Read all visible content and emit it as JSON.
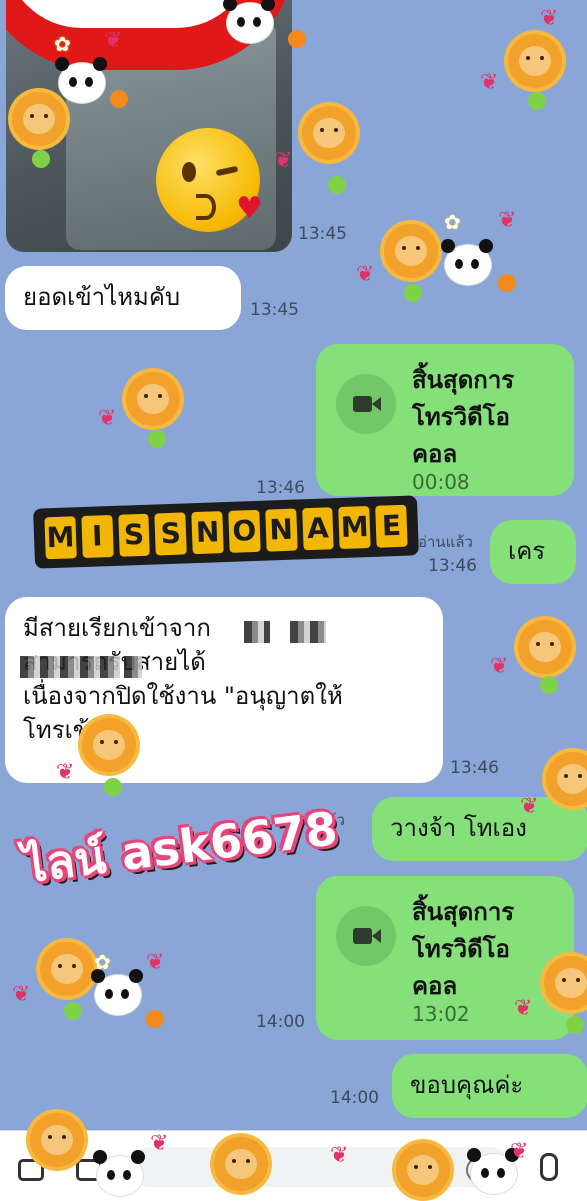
{
  "messages": {
    "image": {
      "time": "13:45"
    },
    "in1": {
      "text": "ยอดเข้าไหมคับ",
      "time": "13:45"
    },
    "call1": {
      "title": "สิ้นสุดการ\nโทรวิดีโอ\nคอล",
      "duration": "00:08",
      "time": "13:46"
    },
    "out1": {
      "text": "เคร",
      "read": "อ่านแล้ว",
      "time": "13:46"
    },
    "in2": {
      "text": "มีสายเรียกเข้าจาก\nสามารถรับสายได้\nเนื่องจากปิดใช้งาน \"อนุญาตให้\nโทรเข้",
      "time": "13:46"
    },
    "out2": {
      "text": "วางจ้า โทเอง",
      "read": "อ่านแล้ว"
    },
    "call2": {
      "title": "สิ้นสุดการ\nโทรวิดีโอ\nคอล",
      "duration": "13:02",
      "time": "14:00"
    },
    "out3": {
      "text": "ขอบคุณค่ะ",
      "time": "14:00"
    }
  },
  "watermark": {
    "letters": [
      "M",
      "I",
      "S",
      "S",
      "N",
      "O",
      "N",
      "A",
      "M",
      "E"
    ]
  },
  "overlay": {
    "line_id": "ไลน์ ask6678"
  },
  "colors": {
    "chat_bg": "#8aa6d6",
    "outgoing": "#85e07a",
    "incoming": "#ffffff",
    "banner": "#f2b705",
    "line_id_stroke": "#e8447a"
  },
  "icons": [
    "camera-icon",
    "image-icon",
    "emoji-icon",
    "mic-icon",
    "video-call-icon"
  ]
}
